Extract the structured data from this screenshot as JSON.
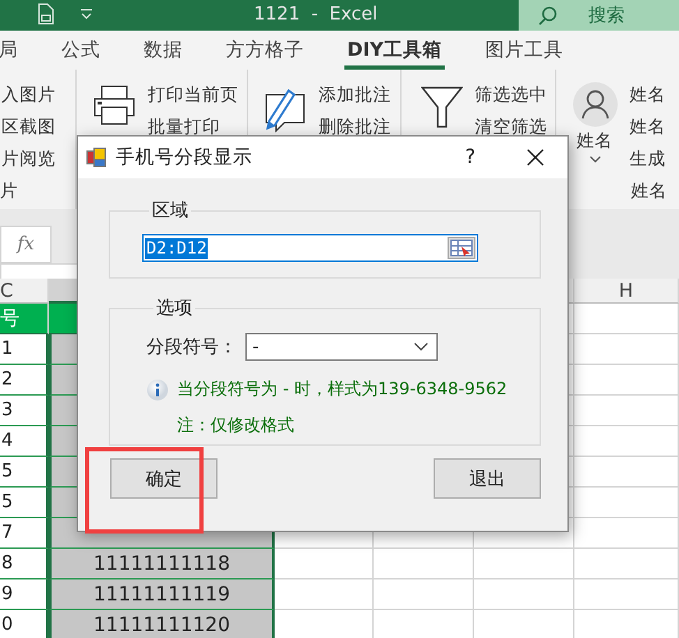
{
  "title_bar": {
    "title": "1121  -  Excel",
    "search": {
      "placeholder": "搜索"
    }
  },
  "ribbon_tabs": [
    {
      "label": "局",
      "selected": false
    },
    {
      "label": "公式",
      "selected": false
    },
    {
      "label": "数据",
      "selected": false
    },
    {
      "label": "方方格子",
      "selected": false
    },
    {
      "label": "DIY工具箱",
      "selected": true
    },
    {
      "label": "图片工具",
      "selected": false
    }
  ],
  "ribbon_groups": [
    {
      "kind": "text-list",
      "commands": [
        "入图片",
        "区截图",
        "片阅览"
      ],
      "group_label": "片"
    },
    {
      "kind": "printer",
      "commands": [
        "打印当前页",
        "批量打印"
      ]
    },
    {
      "kind": "comment",
      "commands": [
        "添加批注",
        "删除批注"
      ]
    },
    {
      "kind": "filter",
      "commands": [
        "筛选选中",
        "清空筛选"
      ]
    },
    {
      "kind": "person",
      "large_button": "姓名",
      "commands": [
        "姓名",
        "姓名",
        "生成"
      ],
      "group_label": "姓名"
    }
  ],
  "formula_bar": {
    "function_button": "fx"
  },
  "sheet": {
    "visible_column_labels": [
      "C",
      "H"
    ],
    "rows": [
      {
        "kind": "header",
        "cells": [
          "号"
        ]
      },
      {
        "kind": "data",
        "selected": true,
        "cells": [
          "1"
        ]
      },
      {
        "kind": "data",
        "selected": true,
        "cells": [
          "2"
        ]
      },
      {
        "kind": "data",
        "selected": true,
        "cells": [
          "3"
        ]
      },
      {
        "kind": "data",
        "selected": true,
        "cells": [
          "4"
        ]
      },
      {
        "kind": "data",
        "selected": true,
        "cells": [
          "5"
        ]
      },
      {
        "kind": "data",
        "selected": true,
        "cells": [
          "5"
        ]
      },
      {
        "kind": "data",
        "selected": true,
        "cells": [
          "7"
        ]
      },
      {
        "kind": "data",
        "selected": true,
        "cells": [
          "8",
          "11111111118"
        ]
      },
      {
        "kind": "data",
        "selected": true,
        "cells": [
          "9",
          "11111111119"
        ]
      },
      {
        "kind": "data",
        "selected": true,
        "cells": [
          "0",
          "11111111120"
        ]
      }
    ]
  },
  "dialog": {
    "title": "手机号分段显示",
    "help": "?",
    "range_group": {
      "legend": "区域",
      "value": "D2:D12"
    },
    "options_group": {
      "legend": "选项",
      "separator_label": "分段符号：",
      "separator_value": "-",
      "hint": "当分段符号为 - 时，样式为139-6348-9562",
      "note": "注：仅修改格式"
    },
    "buttons": [
      "确定",
      "退出"
    ]
  },
  "annotation": {
    "kind": "rectangle"
  }
}
